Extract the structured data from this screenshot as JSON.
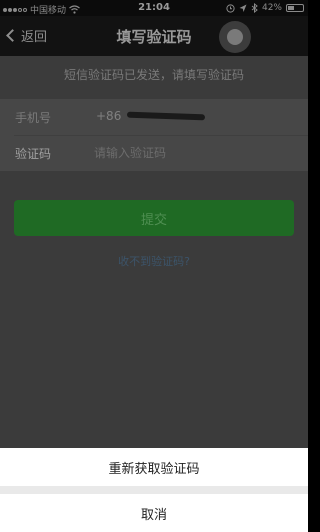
{
  "status_bar": {
    "carrier": "中国移动",
    "time": "21:04",
    "battery_percent": "42%",
    "battery_level": 0.42,
    "icons": [
      "signal-dots",
      "wifi",
      "alarm",
      "location",
      "bluetooth",
      "battery"
    ]
  },
  "nav": {
    "back_label": "返回",
    "title": "填写验证码"
  },
  "notice": "短信验证码已发送，请填写验证码",
  "form": {
    "phone_label": "手机号",
    "phone_prefix": "+86",
    "code_label": "验证码",
    "code_placeholder": "请输入验证码",
    "code_value": ""
  },
  "submit_label": "提交",
  "help_link": "收不到验证码?",
  "action_sheet": {
    "resend_label": "重新获取验证码",
    "cancel_label": "取消"
  }
}
